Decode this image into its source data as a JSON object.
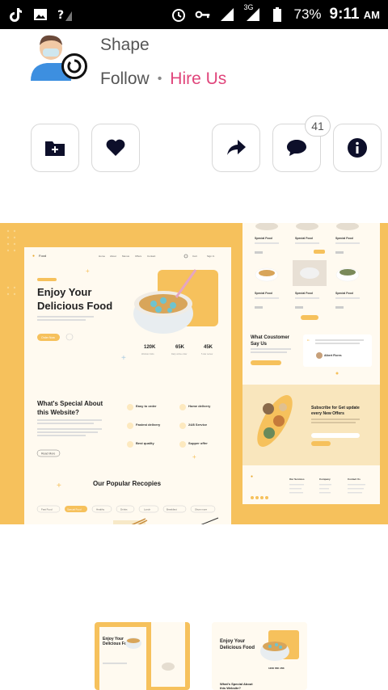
{
  "status_bar": {
    "battery": "73%",
    "time": "9:11",
    "ampm": "AM",
    "network": "3G"
  },
  "profile": {
    "name": "Shape",
    "follow_label": "Follow",
    "separator": "•",
    "hire_label": "Hire Us"
  },
  "actions": {
    "comment_count": "41",
    "icons": [
      "folder-add-icon",
      "heart-icon",
      "share-icon",
      "comment-icon",
      "info-icon"
    ]
  },
  "design": {
    "brand": "Food",
    "nav": [
      "Home",
      "About",
      "Menus",
      "Offers",
      "Contact"
    ],
    "hero_title_1": "Enjoy Your",
    "hero_title_2": "Delicious Food",
    "order_btn": "Order Now",
    "stats": [
      {
        "value": "120K",
        "label": "Website Visits"
      },
      {
        "value": "65K",
        "label": "Daily online order"
      },
      {
        "value": "45K",
        "label": "5 star review"
      }
    ],
    "special_title_1": "What's Special About",
    "special_title_2": "this Website?",
    "read_more": "Read More",
    "features": [
      "Easy to order",
      "Home delivery",
      "Fastest delivery",
      "24/8 Service",
      "Best quality",
      "Supper offer"
    ],
    "popular_title": "Our Popular Recopies",
    "filters": [
      "Fast Food",
      "Special Food",
      "Healthy",
      "Drinks",
      "Lunch",
      "Breakfast",
      "Show more"
    ],
    "product_label": "Special Food",
    "customer_title_1": "What Coustomer",
    "customer_title_2": "Say Us",
    "reviewer": "Albert Flores",
    "subscribe_title_1": "Subscribe for Get update",
    "subscribe_title_2": "every New Offers",
    "footer_cols": [
      "Our Services",
      "Company",
      "Contact Us"
    ]
  },
  "colors": {
    "accent": "#f6c15c",
    "hire": "#e0457b",
    "status_bg": "#000000"
  }
}
